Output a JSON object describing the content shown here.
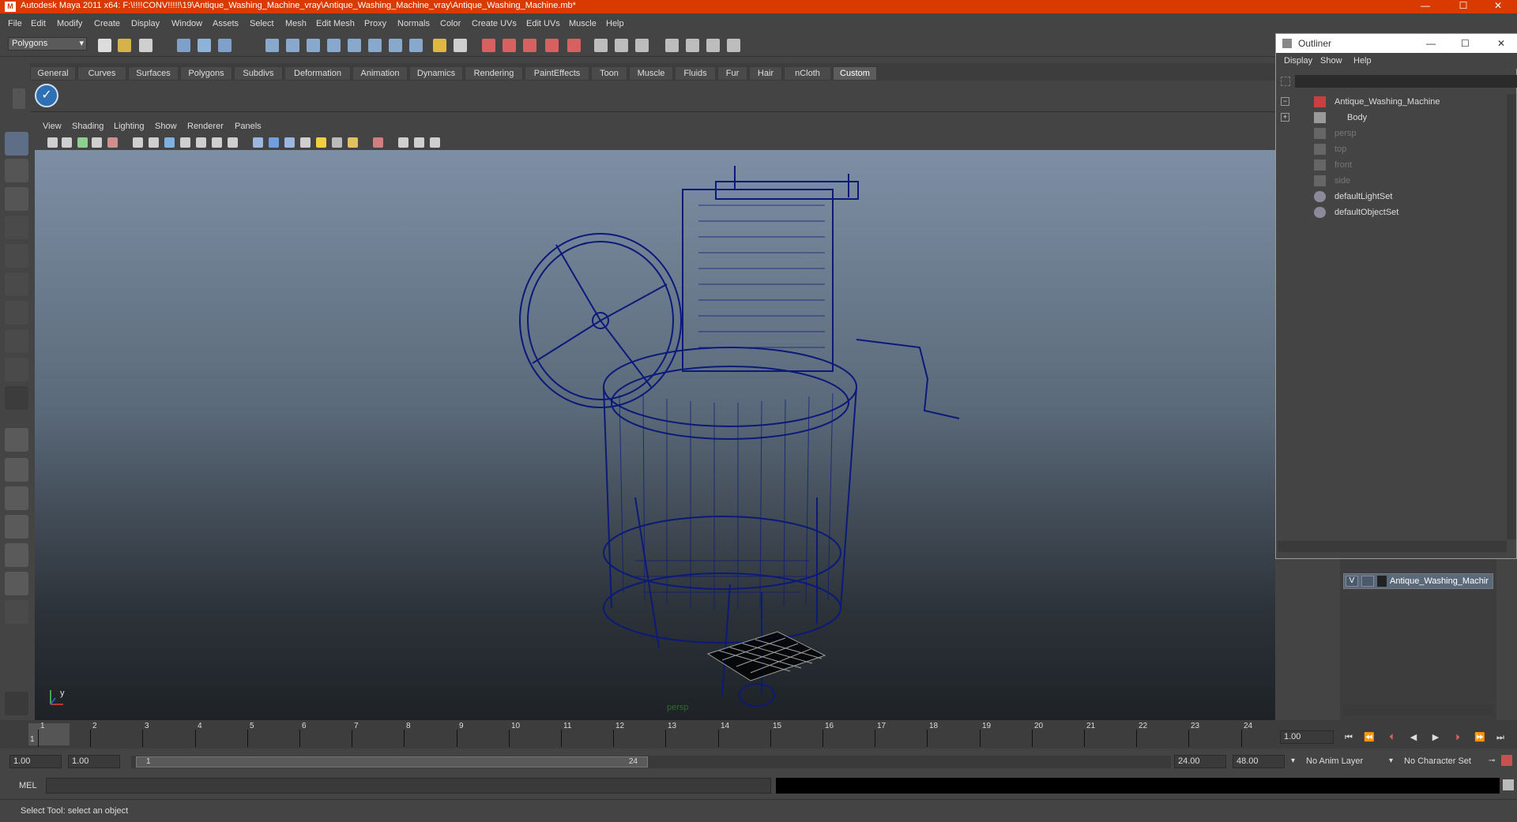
{
  "window": {
    "title": "Autodesk Maya 2011 x64: F:\\!!!!CONV!!!!!\\19\\Antique_Washing_Machine_vray\\Antique_Washing_Machine_vray\\Antique_Washing_Machine.mb*",
    "logo": "M",
    "minimize": "—",
    "maximize": "☐",
    "close": "✕"
  },
  "menubar": [
    "File",
    "Edit",
    "Modify",
    "Create",
    "Display",
    "Window",
    "Assets",
    "Select",
    "Mesh",
    "Edit Mesh",
    "Proxy",
    "Normals",
    "Color",
    "Create UVs",
    "Edit UVs",
    "Muscle",
    "Help"
  ],
  "statusline": {
    "mode": "Polygons"
  },
  "shelf_tabs": [
    "General",
    "Curves",
    "Surfaces",
    "Polygons",
    "Subdivs",
    "Deformation",
    "Animation",
    "Dynamics",
    "Rendering",
    "PaintEffects",
    "Toon",
    "Muscle",
    "Fluids",
    "Fur",
    "Hair",
    "nCloth",
    "Custom"
  ],
  "shelf_active": "Custom",
  "viewport": {
    "menu": [
      "View",
      "Shading",
      "Lighting",
      "Show",
      "Renderer",
      "Panels"
    ],
    "camera": "persp",
    "axis_y": "y"
  },
  "outliner": {
    "title": "Outliner",
    "menu": [
      "Display",
      "Show",
      "Help"
    ],
    "items": [
      {
        "label": "Antique_Washing_Machine",
        "dim": false
      },
      {
        "label": "Body",
        "dim": false
      },
      {
        "label": "persp",
        "dim": true
      },
      {
        "label": "top",
        "dim": true
      },
      {
        "label": "front",
        "dim": true
      },
      {
        "label": "side",
        "dim": true
      },
      {
        "label": "defaultLightSet",
        "dim": false
      },
      {
        "label": "defaultObjectSet",
        "dim": false
      }
    ]
  },
  "layers": {
    "visible_flag": "V",
    "layer_name": "Antique_Washing_Machir"
  },
  "timeline": {
    "ticks": [
      "1",
      "2",
      "3",
      "4",
      "5",
      "6",
      "7",
      "8",
      "9",
      "10",
      "11",
      "12",
      "13",
      "14",
      "15",
      "16",
      "17",
      "18",
      "19",
      "20",
      "21",
      "22",
      "23",
      "24"
    ],
    "current_frame_marker": "1",
    "current_time": "1.00"
  },
  "range": {
    "start_time": "1.00",
    "playback_start": "1.00",
    "range_start_label": "1",
    "range_end_label": "24",
    "playback_end": "24.00",
    "end_time": "48.00",
    "anim_layer": "No Anim Layer",
    "character_set": "No Character Set"
  },
  "command": {
    "lang": "MEL"
  },
  "help": {
    "text": "Select Tool: select an object"
  },
  "colors": {
    "titlebar": "#d83a00",
    "wireframe": "#0b1a78",
    "panel": "#444444"
  }
}
